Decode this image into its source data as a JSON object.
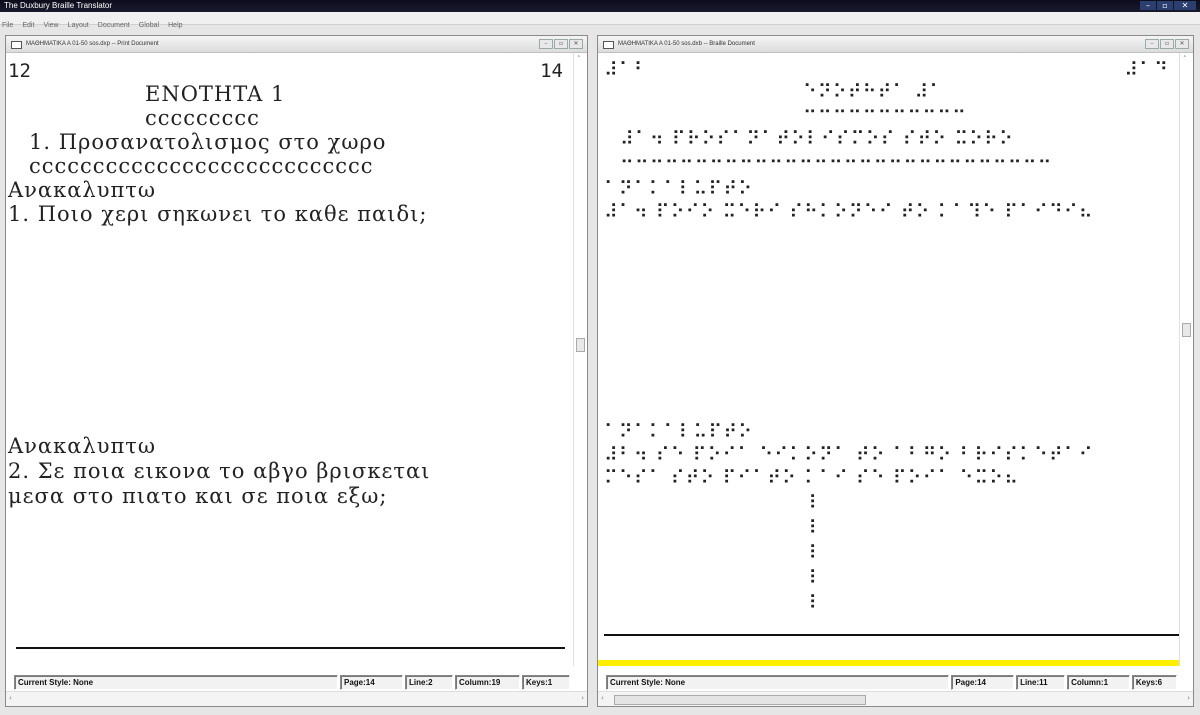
{
  "app": {
    "title": "The Duxbury Braille Translator",
    "window_controls": [
      "–",
      "▫",
      "✕"
    ]
  },
  "menu": [
    "File",
    "Edit",
    "View",
    "Layout",
    "Document",
    "Global",
    "Help"
  ],
  "print_doc": {
    "title": "MAΘHMATIKA A 01-50 sos.dxp -- Print Document",
    "page_number_left": "12",
    "page_number_right": "14",
    "lines": [
      "ENOTHTA 1",
      "ccccccccc",
      "1. Προσανατολισμος στο χωρο",
      "ccccccccccccccccccccccccccc",
      "Ανακαλυπτω",
      "1. Ποιο χερι σηκωνει το καθε παιδι;",
      "Ανακαλυπτω",
      "2. Σε ποια εικονα το αβγο βρισκεται",
      "μεσα στο πιατο και σε ποια εξω;"
    ],
    "status": {
      "style": "Current Style: None",
      "page": "Page:14",
      "line": "Line:2",
      "column": "Column:19",
      "keys": "Keys:1"
    }
  },
  "braille_doc": {
    "title": "MAΘHMATIKA A 01-50 sos.dxb -- Braille Document",
    "page_number_left": "⠼⠁⠃",
    "page_number_right": "⠼⠁⠙",
    "lines": [
      "⠑⠝⠕⠞⠓⠞⠁ ⠼⠁",
      "⠒⠒⠒⠒⠒⠒⠒⠒⠒⠒⠒",
      "⠼⠁⠲ ⠏⠗⠕⠎⠁⠝⠁⠞⠕⠇⠊⠎⠍⠕⠎ ⠎⠞⠕ ⠭⠕⠗⠕",
      "⠒⠒⠒⠒⠒⠒⠒⠒⠒⠒⠒⠒⠒⠒⠒⠒⠒⠒⠒⠒⠒⠒⠒⠒⠒⠒⠒⠒⠒",
      "⠁⠝⠁⠅⠁⠇⠥⠏⠞⠕",
      "⠼⠁⠲ ⠏⠕⠊⠕ ⠭⠑⠗⠊ ⠎⠓⠅⠕⠝⠑⠊ ⠞⠕ ⠅⠁⠹⠑ ⠏⠁⠊⠙⠊⠦",
      "⠁⠝⠁⠅⠁⠇⠥⠏⠞⠕",
      "⠼⠃⠲ ⠎⠑ ⠏⠕⠊⠁ ⠑⠊⠅⠕⠝⠁ ⠞⠕ ⠁⠃⠛⠕ ⠃⠗⠊⠎⠅⠑⠞⠁⠊",
      "⠍⠑⠎⠁ ⠎⠞⠕ ⠏⠊⠁⠞⠕ ⠅⠁⠊ ⠎⠑ ⠏⠕⠊⠁ ⠑⠭⠕⠦",
      "⠸",
      "⠸",
      "⠸",
      "⠸",
      "⠸"
    ],
    "status": {
      "style": "Current Style: None",
      "page": "Page:14",
      "line": "Line:11",
      "column": "Column:1",
      "keys": "Keys:6"
    }
  },
  "colors": {
    "highlight_bar": "#ffee00",
    "title_bar": "#0c0c1c"
  }
}
